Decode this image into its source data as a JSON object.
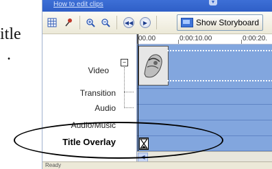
{
  "page_text": {
    "line1": "itle",
    "line2": "."
  },
  "app": {
    "title": "How to edit clips",
    "toolbar": {
      "storyboard_label": "Show Storyboard",
      "icons": [
        "storyboard-grid-icon",
        "pin-icon",
        "zoom-in-icon",
        "zoom-out-icon",
        "rewind-icon",
        "play-icon"
      ]
    },
    "ruler": [
      "00.00",
      "0:00:10.00",
      "0:00:20."
    ],
    "tracks": {
      "video": "Video",
      "collapse_symbol": "−",
      "transition": "Transition",
      "audio": "Audio",
      "audio_music": "Audio/Music",
      "title_overlay": "Title Overlay"
    },
    "status": "Ready"
  },
  "colors": {
    "track_blue": "#82a6de",
    "titlebar_blue": "#2f5fc7",
    "toolbar_bg": "#ece9d8"
  }
}
